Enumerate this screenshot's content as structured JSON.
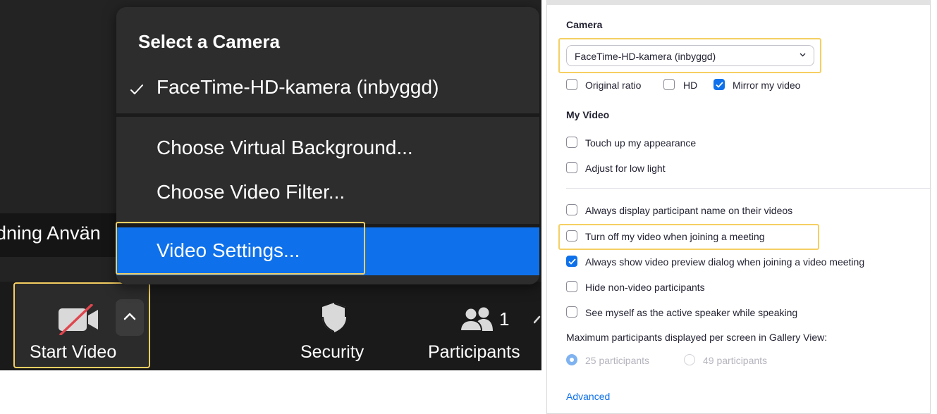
{
  "meeting": {
    "participant_name_fragment": "dning Använ",
    "menu": {
      "title": "Select a Camera",
      "camera_option": "FaceTime-HD-kamera (inbyggd)",
      "virtual_background": "Choose Virtual Background...",
      "video_filter": "Choose Video Filter...",
      "video_settings": "Video Settings..."
    },
    "toolbar": {
      "start_video": "Start Video",
      "security": "Security",
      "participants": "Participants",
      "participants_count": "1"
    },
    "colors": {
      "accent": "#0e71eb",
      "highlight": "#f5cf62",
      "menu_bg": "#2d2d2d"
    }
  },
  "settings": {
    "camera_heading": "Camera",
    "camera_select_value": "FaceTime-HD-kamera (inbyggd)",
    "original_ratio": "Original ratio",
    "hd": "HD",
    "mirror": "Mirror my video",
    "my_video_heading": "My Video",
    "touch_up": "Touch up my appearance",
    "low_light": "Adjust for low light",
    "display_name": "Always display participant name on their videos",
    "turn_off": "Turn off my video when joining a meeting",
    "preview_dialog": "Always show video preview dialog when joining a video meeting",
    "hide_nonvideo": "Hide non-video participants",
    "active_speaker": "See myself as the active speaker while speaking",
    "max_participants": "Maximum participants displayed per screen in Gallery View:",
    "option_25": "25 participants",
    "option_49": "49 participants",
    "advanced": "Advanced",
    "checked": {
      "original_ratio": false,
      "hd": false,
      "mirror": true,
      "touch_up": false,
      "low_light": false,
      "display_name": false,
      "turn_off": false,
      "preview_dialog": true,
      "hide_nonvideo": false,
      "active_speaker": false
    },
    "selected_gallery_option": "25 participants"
  }
}
